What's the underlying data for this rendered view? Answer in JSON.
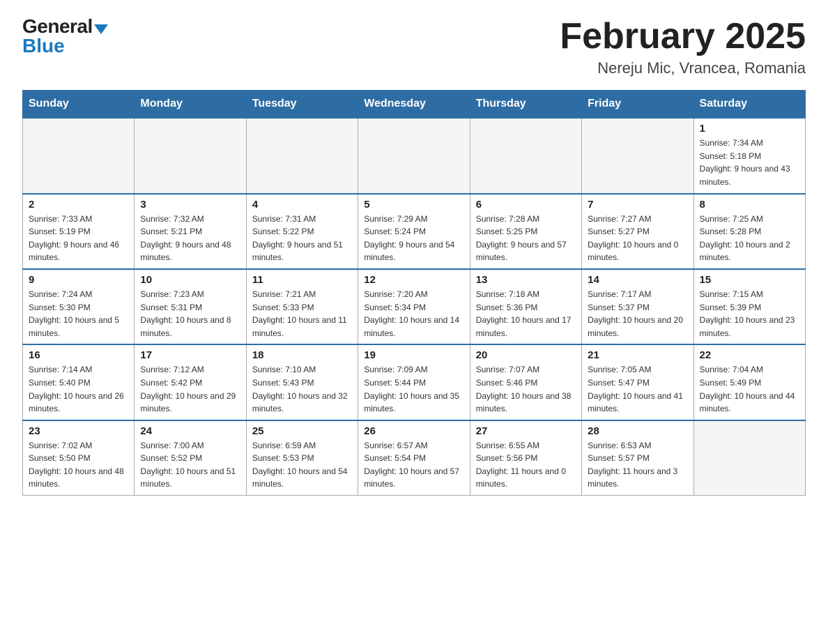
{
  "header": {
    "logo_general": "General",
    "logo_blue": "Blue",
    "month_title": "February 2025",
    "location": "Nereju Mic, Vrancea, Romania"
  },
  "days_of_week": [
    "Sunday",
    "Monday",
    "Tuesday",
    "Wednesday",
    "Thursday",
    "Friday",
    "Saturday"
  ],
  "weeks": [
    [
      {
        "day": "",
        "info": ""
      },
      {
        "day": "",
        "info": ""
      },
      {
        "day": "",
        "info": ""
      },
      {
        "day": "",
        "info": ""
      },
      {
        "day": "",
        "info": ""
      },
      {
        "day": "",
        "info": ""
      },
      {
        "day": "1",
        "info": "Sunrise: 7:34 AM\nSunset: 5:18 PM\nDaylight: 9 hours and 43 minutes."
      }
    ],
    [
      {
        "day": "2",
        "info": "Sunrise: 7:33 AM\nSunset: 5:19 PM\nDaylight: 9 hours and 46 minutes."
      },
      {
        "day": "3",
        "info": "Sunrise: 7:32 AM\nSunset: 5:21 PM\nDaylight: 9 hours and 48 minutes."
      },
      {
        "day": "4",
        "info": "Sunrise: 7:31 AM\nSunset: 5:22 PM\nDaylight: 9 hours and 51 minutes."
      },
      {
        "day": "5",
        "info": "Sunrise: 7:29 AM\nSunset: 5:24 PM\nDaylight: 9 hours and 54 minutes."
      },
      {
        "day": "6",
        "info": "Sunrise: 7:28 AM\nSunset: 5:25 PM\nDaylight: 9 hours and 57 minutes."
      },
      {
        "day": "7",
        "info": "Sunrise: 7:27 AM\nSunset: 5:27 PM\nDaylight: 10 hours and 0 minutes."
      },
      {
        "day": "8",
        "info": "Sunrise: 7:25 AM\nSunset: 5:28 PM\nDaylight: 10 hours and 2 minutes."
      }
    ],
    [
      {
        "day": "9",
        "info": "Sunrise: 7:24 AM\nSunset: 5:30 PM\nDaylight: 10 hours and 5 minutes."
      },
      {
        "day": "10",
        "info": "Sunrise: 7:23 AM\nSunset: 5:31 PM\nDaylight: 10 hours and 8 minutes."
      },
      {
        "day": "11",
        "info": "Sunrise: 7:21 AM\nSunset: 5:33 PM\nDaylight: 10 hours and 11 minutes."
      },
      {
        "day": "12",
        "info": "Sunrise: 7:20 AM\nSunset: 5:34 PM\nDaylight: 10 hours and 14 minutes."
      },
      {
        "day": "13",
        "info": "Sunrise: 7:18 AM\nSunset: 5:36 PM\nDaylight: 10 hours and 17 minutes."
      },
      {
        "day": "14",
        "info": "Sunrise: 7:17 AM\nSunset: 5:37 PM\nDaylight: 10 hours and 20 minutes."
      },
      {
        "day": "15",
        "info": "Sunrise: 7:15 AM\nSunset: 5:39 PM\nDaylight: 10 hours and 23 minutes."
      }
    ],
    [
      {
        "day": "16",
        "info": "Sunrise: 7:14 AM\nSunset: 5:40 PM\nDaylight: 10 hours and 26 minutes."
      },
      {
        "day": "17",
        "info": "Sunrise: 7:12 AM\nSunset: 5:42 PM\nDaylight: 10 hours and 29 minutes."
      },
      {
        "day": "18",
        "info": "Sunrise: 7:10 AM\nSunset: 5:43 PM\nDaylight: 10 hours and 32 minutes."
      },
      {
        "day": "19",
        "info": "Sunrise: 7:09 AM\nSunset: 5:44 PM\nDaylight: 10 hours and 35 minutes."
      },
      {
        "day": "20",
        "info": "Sunrise: 7:07 AM\nSunset: 5:46 PM\nDaylight: 10 hours and 38 minutes."
      },
      {
        "day": "21",
        "info": "Sunrise: 7:05 AM\nSunset: 5:47 PM\nDaylight: 10 hours and 41 minutes."
      },
      {
        "day": "22",
        "info": "Sunrise: 7:04 AM\nSunset: 5:49 PM\nDaylight: 10 hours and 44 minutes."
      }
    ],
    [
      {
        "day": "23",
        "info": "Sunrise: 7:02 AM\nSunset: 5:50 PM\nDaylight: 10 hours and 48 minutes."
      },
      {
        "day": "24",
        "info": "Sunrise: 7:00 AM\nSunset: 5:52 PM\nDaylight: 10 hours and 51 minutes."
      },
      {
        "day": "25",
        "info": "Sunrise: 6:59 AM\nSunset: 5:53 PM\nDaylight: 10 hours and 54 minutes."
      },
      {
        "day": "26",
        "info": "Sunrise: 6:57 AM\nSunset: 5:54 PM\nDaylight: 10 hours and 57 minutes."
      },
      {
        "day": "27",
        "info": "Sunrise: 6:55 AM\nSunset: 5:56 PM\nDaylight: 11 hours and 0 minutes."
      },
      {
        "day": "28",
        "info": "Sunrise: 6:53 AM\nSunset: 5:57 PM\nDaylight: 11 hours and 3 minutes."
      },
      {
        "day": "",
        "info": ""
      }
    ]
  ]
}
